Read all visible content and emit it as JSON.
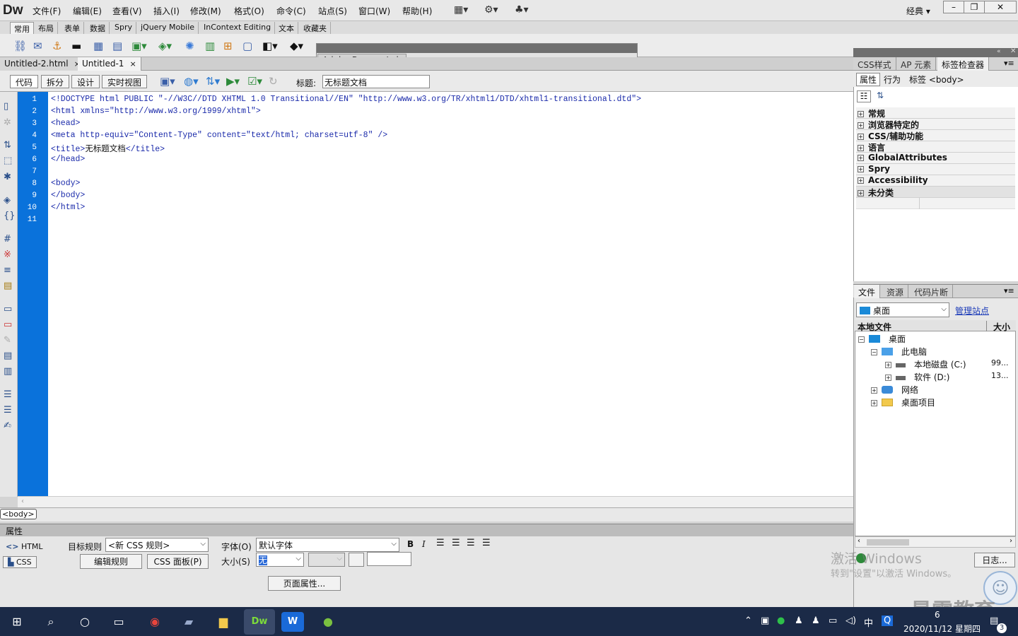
{
  "app": {
    "logo": "Dw",
    "mode": "经典",
    "min": "–",
    "max": "❐",
    "close": "✕"
  },
  "menu": [
    "文件(F)",
    "编辑(E)",
    "查看(V)",
    "插入(I)",
    "修改(M)",
    "格式(O)",
    "命令(C)",
    "站点(S)",
    "窗口(W)",
    "帮助(H)"
  ],
  "insert_tabs": [
    "常用",
    "布局",
    "表单",
    "数据",
    "Spry",
    "jQuery Mobile",
    "InContext Editing",
    "文本",
    "收藏夹"
  ],
  "floating_panel": {
    "title": "Adobe BrowserLab"
  },
  "doc_tabs": [
    {
      "label": "Untitled-2.html",
      "close": "×"
    },
    {
      "label": "Untitled-1",
      "close": "×"
    }
  ],
  "view_buttons": [
    "代码",
    "拆分",
    "设计",
    "实时视图"
  ],
  "title_field": {
    "label": "标题:",
    "value": "无标题文档"
  },
  "line_numbers": [
    "1",
    "2",
    "3",
    "4",
    "5",
    "6",
    "7",
    "8",
    "9",
    "10",
    "11"
  ],
  "code_lines": [
    {
      "pre": "<!DOCTYPE html PUBLIC \"-//W3C//DTD XHTML 1.0 Transitional//EN\" \"http://www.w3.org/TR/xhtml1/DTD/xhtml1-transitional.dtd\">",
      "text": "",
      "post": ""
    },
    {
      "pre": "<html xmlns=\"http://www.w3.org/1999/xhtml\">",
      "text": "",
      "post": ""
    },
    {
      "pre": "<head>",
      "text": "",
      "post": ""
    },
    {
      "pre": "<meta http-equiv=\"Content-Type\" content=\"text/html; charset=utf-8\" />",
      "text": "",
      "post": ""
    },
    {
      "pre": "<title>",
      "text": "无标题文档",
      "post": "</title>"
    },
    {
      "pre": "</head>",
      "text": "",
      "post": ""
    },
    {
      "pre": "",
      "text": "",
      "post": ""
    },
    {
      "pre": "<body>",
      "text": "",
      "post": ""
    },
    {
      "pre": "</body>",
      "text": "",
      "post": ""
    },
    {
      "pre": "</html>",
      "text": "",
      "post": ""
    },
    {
      "pre": "",
      "text": "",
      "post": ""
    }
  ],
  "status": {
    "tag": "<body>"
  },
  "props": {
    "header": "属性",
    "html_btn": "HTML",
    "css_btn": "CSS",
    "target_rule_label": "目标规则",
    "target_rule_value": "<新 CSS 规则>",
    "edit_rule": "编辑规则",
    "css_panel": "CSS 面板(P)",
    "font_label": "字体(O)",
    "font_value": "默认字体",
    "size_label": "大小(S)",
    "size_value": "无",
    "bold": "B",
    "italic": "I",
    "page_props": "页面属性..."
  },
  "right_panel1": {
    "tabs": [
      "CSS样式",
      "AP 元素",
      "标签检查器"
    ],
    "sub_tabs": [
      "属性",
      "行为"
    ],
    "tag_label": "标签 <body>",
    "categories": [
      "常规",
      "浏览器特定的",
      "CSS/辅助功能",
      "语言",
      "GlobalAttributes",
      "Spry",
      "Accessibility",
      "未分类"
    ]
  },
  "right_panel2": {
    "tabs": [
      "文件",
      "资源",
      "代码片断"
    ],
    "site": "桌面",
    "manage": "管理站点",
    "col_local": "本地文件",
    "col_size": "大小",
    "tree": [
      {
        "label": "桌面",
        "size": ""
      },
      {
        "label": "此电脑",
        "size": ""
      },
      {
        "label": "本地磁盘 (C:)",
        "size": "99..."
      },
      {
        "label": "软件 (D:)",
        "size": "13..."
      },
      {
        "label": "网络",
        "size": ""
      },
      {
        "label": "桌面项目",
        "size": ""
      }
    ],
    "log_btn": "日志..."
  },
  "watermark": {
    "line1": "激活 Windows",
    "line2": "转到\"设置\"以激活 Windows。",
    "brand": "最需教育"
  },
  "taskbar": {
    "date": "2020/11/12 星期四",
    "time": "6",
    "ime": "中",
    "badge": "3"
  }
}
